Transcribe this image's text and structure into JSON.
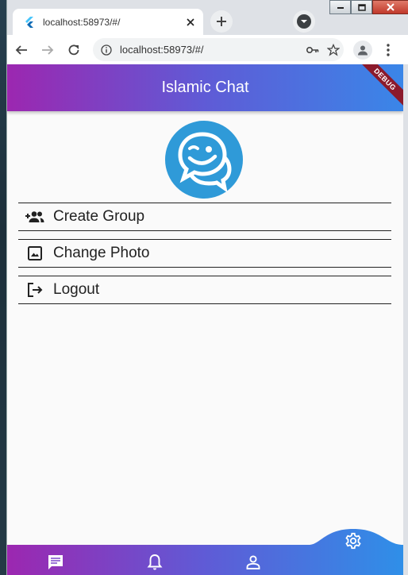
{
  "browser": {
    "tab_title": "localhost:58973/#/",
    "url": "localhost:58973/#/",
    "icons": [
      "flutter-favicon",
      "close-icon",
      "plus-icon",
      "tab-search-icon",
      "back-icon",
      "forward-icon",
      "reload-icon",
      "info-icon",
      "key-icon",
      "star-icon",
      "profile-icon",
      "more-vert-icon",
      "minimize-icon",
      "maximize-icon",
      "window-close-icon"
    ]
  },
  "app": {
    "title": "Islamic Chat",
    "debug_banner": "DEBUG",
    "accent_gradient": [
      "#9c27b0",
      "#3a86e8"
    ],
    "logo_color": "#2f9ad8",
    "menu": [
      {
        "label": "Create Group",
        "icon": "group-add-icon"
      },
      {
        "label": "Change Photo",
        "icon": "image-icon"
      },
      {
        "label": "Logout",
        "icon": "logout-icon"
      }
    ],
    "bottom_nav": [
      {
        "name": "chats",
        "icon": "chat-icon"
      },
      {
        "name": "notifications",
        "icon": "bell-icon"
      },
      {
        "name": "profile",
        "icon": "person-icon"
      },
      {
        "name": "settings",
        "icon": "gear-icon",
        "active": true
      }
    ]
  }
}
